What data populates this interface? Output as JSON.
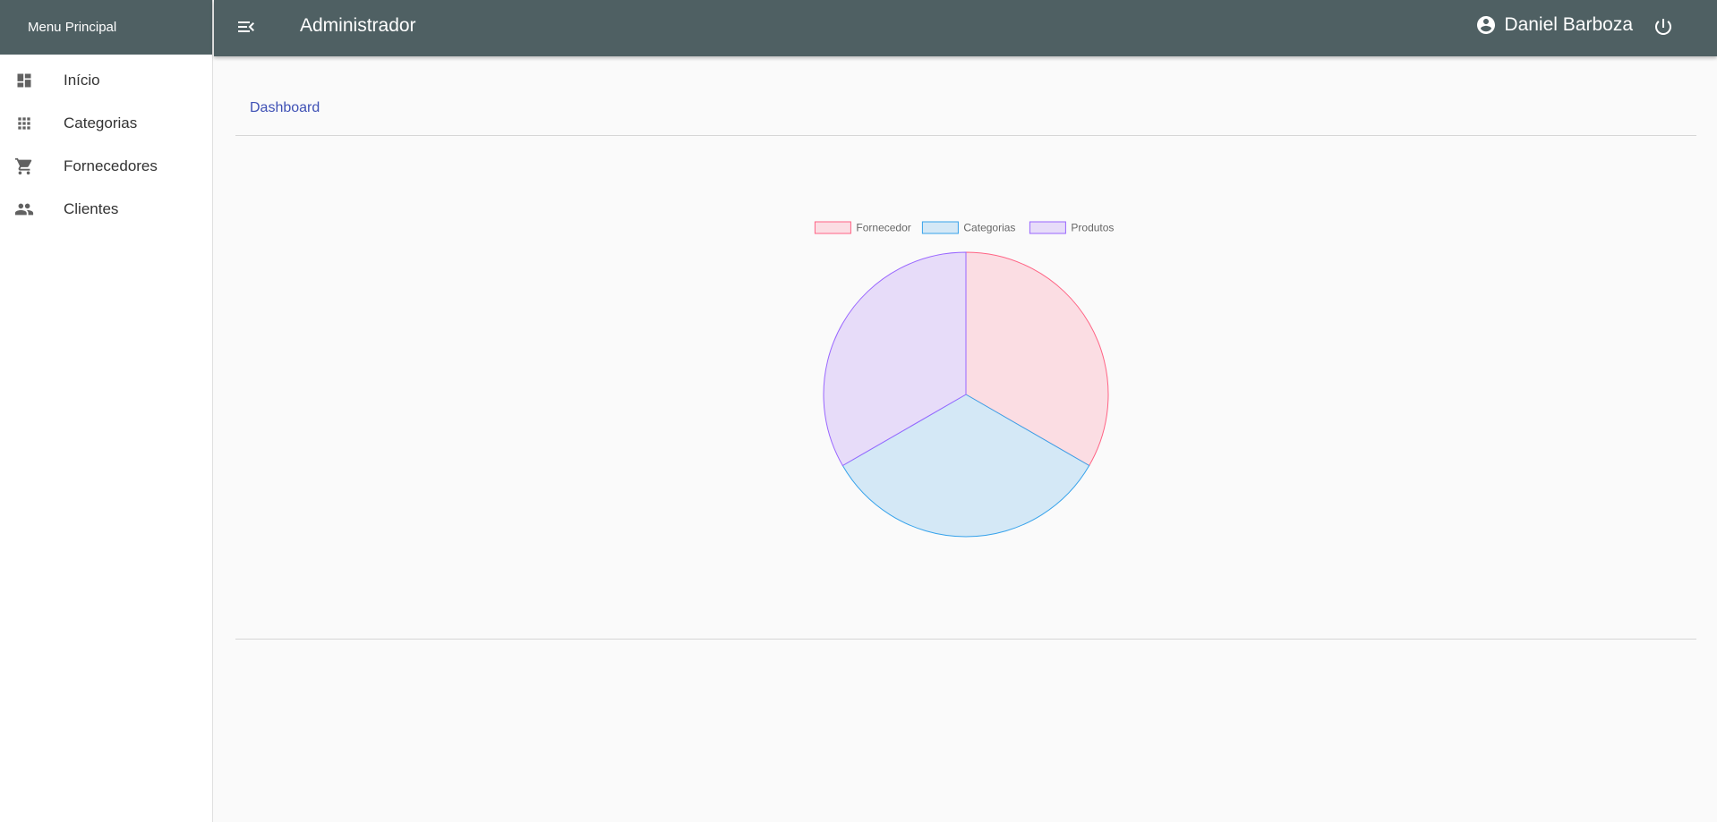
{
  "sidebar": {
    "title": "Menu Principal",
    "items": [
      {
        "label": "Início",
        "icon": "dashboard-icon"
      },
      {
        "label": "Categorias",
        "icon": "apps-grid-icon"
      },
      {
        "label": "Fornecedores",
        "icon": "shopping-cart-icon"
      },
      {
        "label": "Clientes",
        "icon": "people-icon"
      }
    ]
  },
  "topbar": {
    "title": "Administrador",
    "user_name": "Daniel Barboza",
    "menu_icon": "menu-open-icon",
    "user_icon": "account-circle-icon",
    "logout_icon": "power-icon"
  },
  "breadcrumb": "Dashboard",
  "colors": {
    "header_bg": "#4f6063",
    "link": "#3f51b5"
  },
  "chart_data": {
    "type": "pie",
    "categories": [
      "Fornecedor",
      "Categorias",
      "Produtos"
    ],
    "values": [
      1,
      1,
      1
    ],
    "colors": [
      {
        "fill": "#fbdde3",
        "stroke": "#ff6384"
      },
      {
        "fill": "#d4e8f6",
        "stroke": "#36a2eb"
      },
      {
        "fill": "#e7dcf9",
        "stroke": "#9966ff"
      }
    ],
    "legend": "top"
  }
}
